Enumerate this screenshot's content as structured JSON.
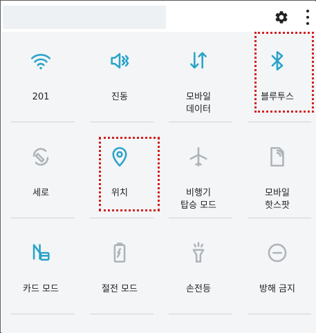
{
  "colors": {
    "active": "#29a3c9",
    "inactive": "#aeb3b8",
    "highlight": "#d21f1f"
  },
  "header": {
    "settings_icon": "gear-icon",
    "more_icon": "more-vertical-icon"
  },
  "tiles": [
    {
      "id": "wifi",
      "label": "201",
      "icon": "wifi-icon",
      "active": true
    },
    {
      "id": "vibrate",
      "label": "진동",
      "icon": "vibrate-icon",
      "active": true
    },
    {
      "id": "mobile-data",
      "label": "모바일\n데이터",
      "icon": "mobile-data-icon",
      "active": true
    },
    {
      "id": "bluetooth",
      "label": "블루투스",
      "icon": "bluetooth-icon",
      "active": true,
      "highlighted": true
    },
    {
      "id": "rotate",
      "label": "세로",
      "icon": "rotate-icon",
      "active": false
    },
    {
      "id": "location",
      "label": "위치",
      "icon": "location-icon",
      "active": true,
      "highlighted": true
    },
    {
      "id": "airplane",
      "label": "비행기\n탑승 모드",
      "icon": "airplane-icon",
      "active": false
    },
    {
      "id": "hotspot",
      "label": "모바일\n핫스팟",
      "icon": "hotspot-icon",
      "active": false
    },
    {
      "id": "card-mode",
      "label": "카드 모드",
      "icon": "card-mode-icon",
      "active": true
    },
    {
      "id": "power-saving",
      "label": "절전 모드",
      "icon": "battery-icon",
      "active": false
    },
    {
      "id": "flashlight",
      "label": "손전등",
      "icon": "flashlight-icon",
      "active": false
    },
    {
      "id": "do-not-disturb",
      "label": "방해 금지",
      "icon": "do-not-disturb-icon",
      "active": false
    }
  ]
}
